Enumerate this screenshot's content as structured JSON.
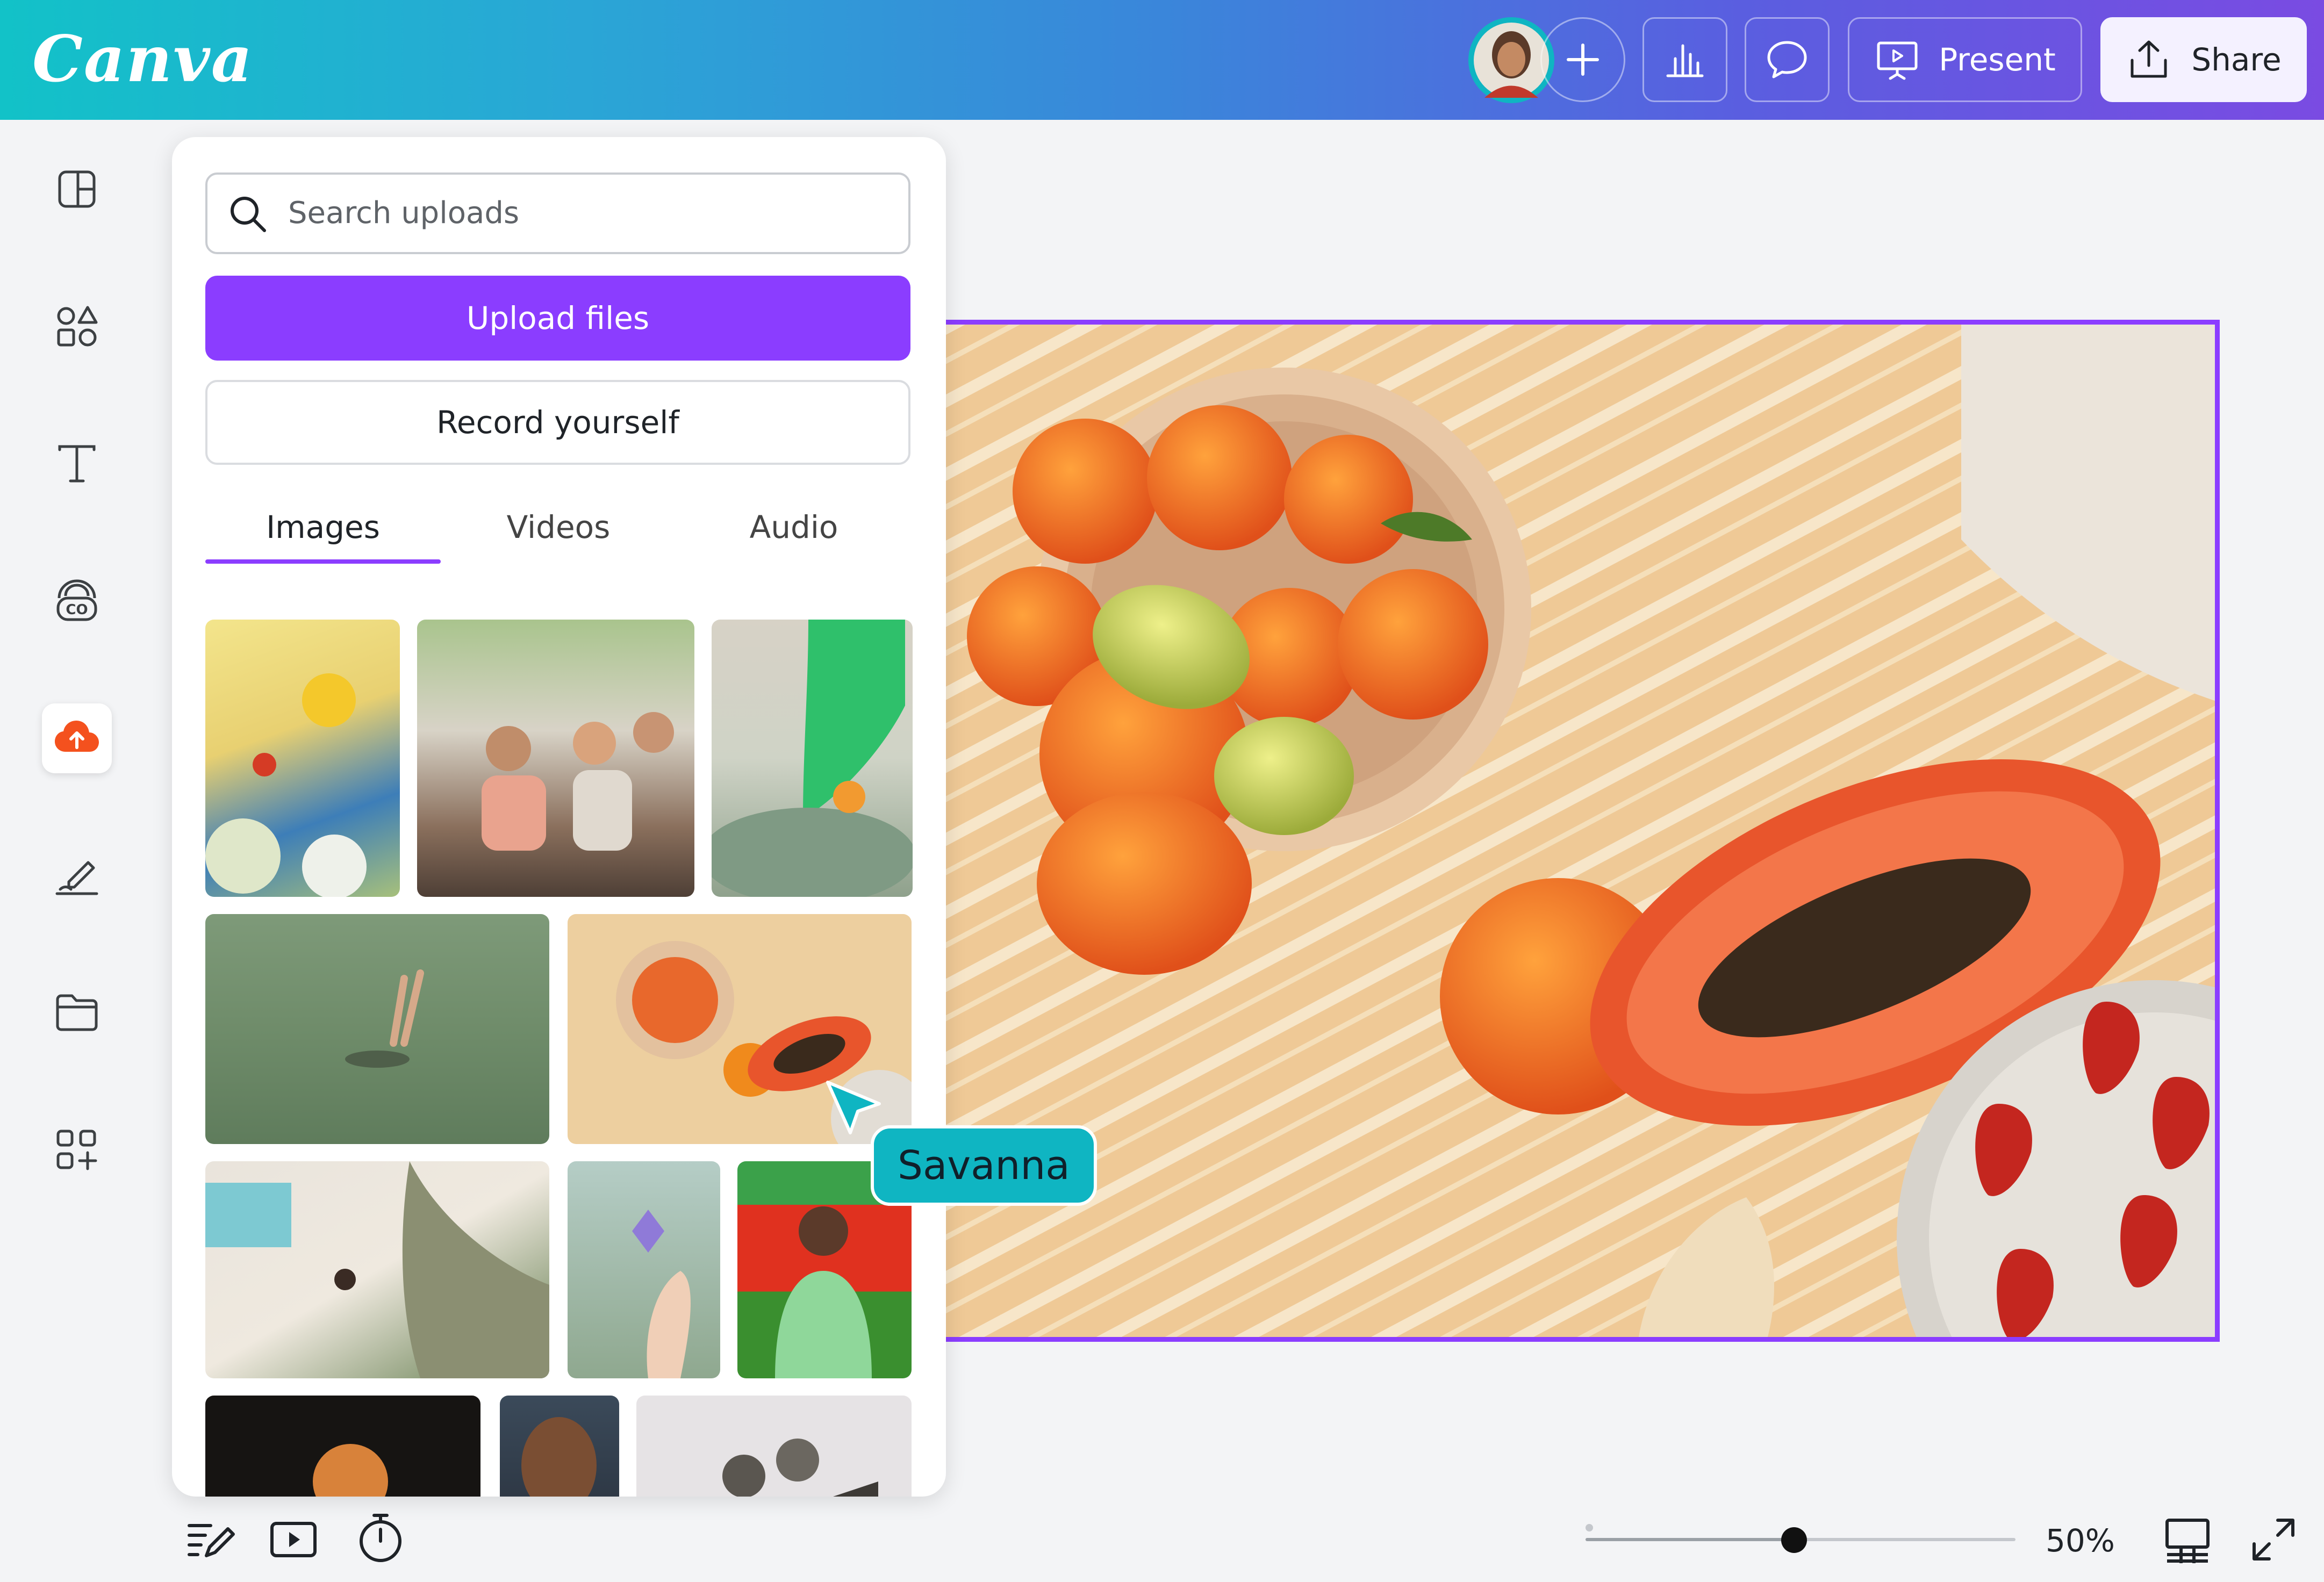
{
  "app": {
    "logo_text": "Canva",
    "brand_color": "#8b3dff"
  },
  "topbar": {
    "add_icon": "plus-icon",
    "insights_icon": "bar-chart-icon",
    "comment_icon": "speech-bubble-icon",
    "present_label": "Present",
    "present_icon": "presentation-screen-icon",
    "share_label": "Share",
    "share_icon": "upload-arrow-icon"
  },
  "sidebar": {
    "items": [
      {
        "name": "design",
        "icon": "layout-icon"
      },
      {
        "name": "elements",
        "icon": "shapes-icon"
      },
      {
        "name": "text",
        "icon": "text-icon"
      },
      {
        "name": "brand",
        "icon": "brand-kit-icon"
      },
      {
        "name": "uploads",
        "icon": "cloud-upload-icon",
        "active": true
      },
      {
        "name": "draw",
        "icon": "pen-icon"
      },
      {
        "name": "projects",
        "icon": "folder-icon"
      },
      {
        "name": "apps",
        "icon": "apps-grid-icon"
      }
    ]
  },
  "uploads_panel": {
    "search_placeholder": "Search uploads",
    "upload_label": "Upload files",
    "record_label": "Record yourself",
    "tabs": [
      {
        "label": "Images",
        "active": true
      },
      {
        "label": "Videos",
        "active": false
      },
      {
        "label": "Audio",
        "active": false
      }
    ]
  },
  "collaborator": {
    "name": "Savanna",
    "color": "#0fb5c2"
  },
  "bottom_bar": {
    "notes_icon": "notes-icon",
    "play_icon": "play-icon",
    "timer_icon": "timer-icon",
    "zoom_level": 0.5,
    "zoom_label": "50%",
    "grid_view_icon": "page-grid-icon",
    "fullscreen_icon": "expand-icon"
  }
}
